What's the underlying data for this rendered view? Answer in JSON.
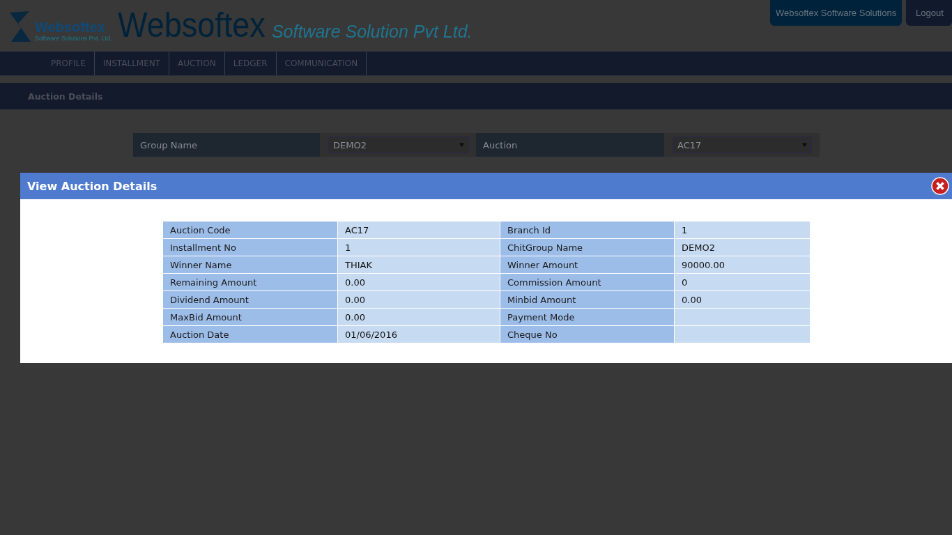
{
  "logo": {
    "name": "Websoftex",
    "tagline": "Software Solutions Pvt. Ltd."
  },
  "brand": {
    "title": "Websoftex",
    "subtitle": "Software Solution Pvt Ltd."
  },
  "top_buttons": [
    "Websoftex Software Solutions",
    "Logout"
  ],
  "menu": [
    {
      "label": "PROFILE",
      "selected": false
    },
    {
      "label": "INSTALLMENT",
      "selected": false
    },
    {
      "label": "AUCTION",
      "selected": false
    },
    {
      "label": "LEDGER",
      "selected": false
    },
    {
      "label": "COMMUNICATION",
      "selected": false
    }
  ],
  "page_title": "Auction Details",
  "filters": [
    {
      "label": "Group Name",
      "value": "DEMO2"
    },
    {
      "label": "Auction",
      "value": "AC17"
    }
  ],
  "dialog": {
    "title": "View Auction Details",
    "rows": [
      {
        "label_1": "Auction Code",
        "value_1": "AC17",
        "label_2": "Branch Id",
        "value_2": "1"
      },
      {
        "label_1": "Installment No",
        "value_1": "1",
        "label_2": "ChitGroup Name",
        "value_2": "DEMO2"
      },
      {
        "label_1": "Winner Name",
        "value_1": "THIAK",
        "label_2": "Winner Amount",
        "value_2": "90000.00"
      },
      {
        "label_1": "Remaining Amount",
        "value_1": "0.00",
        "label_2": "Commission Amount",
        "value_2": "0"
      },
      {
        "label_1": "Dividend Amount",
        "value_1": "0.00",
        "label_2": "Minbid Amount",
        "value_2": "0.00"
      },
      {
        "label_1": "MaxBid Amount",
        "value_1": "0.00",
        "label_2": "Payment Mode",
        "value_2": ""
      },
      {
        "label_1": "Auction Date",
        "value_1": "01/06/2016",
        "label_2": "Cheque No",
        "value_2": ""
      }
    ]
  }
}
